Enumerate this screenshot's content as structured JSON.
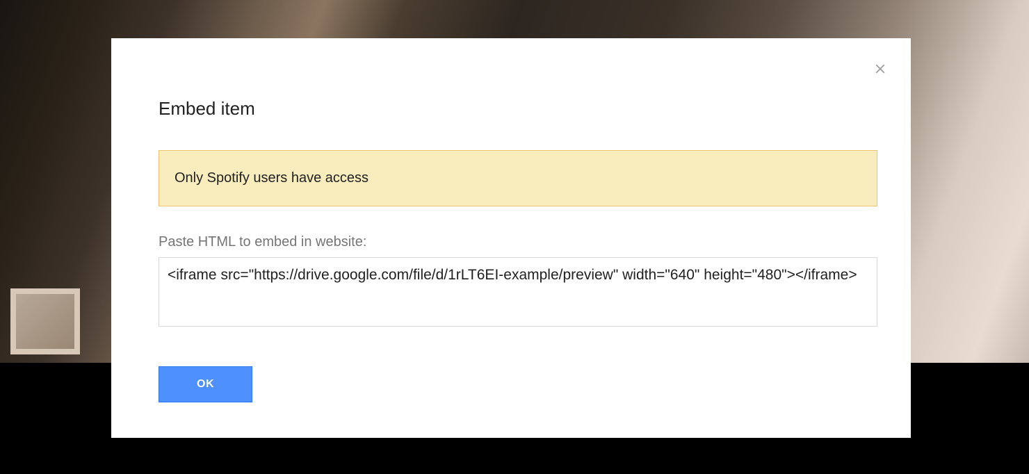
{
  "dialog": {
    "title": "Embed item",
    "notice": "Only Spotify users have access",
    "field_label": "Paste HTML to embed in website:",
    "embed_code": "<iframe src=\"https://drive.google.com/file/d/1rLT6EI-example/preview\" width=\"640\" height=\"480\"></iframe>",
    "ok_label": "OK"
  }
}
